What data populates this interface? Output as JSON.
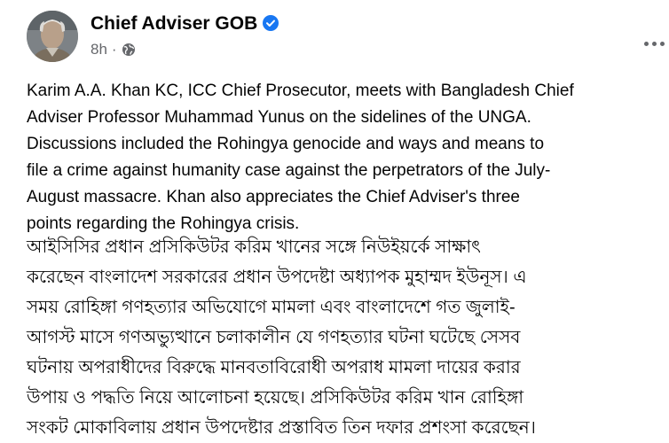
{
  "post": {
    "author": "Chief Adviser GOB",
    "verified": true,
    "time": "8h",
    "separator": "·",
    "privacy_icon": "globe-icon",
    "more_icon": "more-horizontal-icon",
    "accent_color": "#1877f2",
    "english_lines": [
      "Karim A.A. Khan KC, ICC Chief Prosecutor, meets with Bangladesh Chief",
      "Adviser Professor Muhammad Yunus on the sidelines of the UNGA.",
      "Discussions included the Rohingya genocide and ways and means to",
      "file a crime against humanity case against the perpetrators of the July-",
      "August massacre. Khan also appreciates the Chief Adviser's three",
      "points regarding the Rohingya crisis."
    ],
    "bangla_lines": [
      "আইসিসির প্রধান প্রসিকিউটর করিম খানের সঙ্গে নিউইয়র্কে সাক্ষাৎ",
      "করেছেন বাংলাদেশ সরকারের প্রধান উপদেষ্টা অধ্যাপক মুহাম্মদ ইউনূস। এ",
      "সময় রোহিঙ্গা গণহত্যার অভিযোগে মামলা এবং বাংলাদেশে গত জুলাই-",
      "আগস্ট মাসে গণঅভ্যুত্থানে চলাকালীন যে গণহত্যার ঘটনা ঘটেছে সেসব",
      "ঘটনায় অপরাধীদের বিরুদ্ধে মানবতাবিরোধী অপরাধ মামলা দায়ের করার",
      "উপায়  ও পদ্ধতি নিয়ে আলোচনা হয়েছে। প্রসিকিউটর করিম খান রোহিঙ্গা",
      "সংকট মোকাবিলায় প্রধান উপদেষ্টার প্রস্তাবিত তিন দফার প্রশংসা করেছেন।"
    ]
  }
}
